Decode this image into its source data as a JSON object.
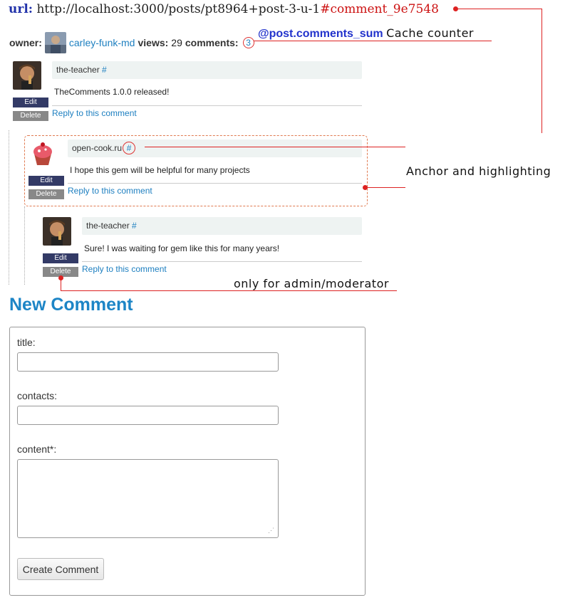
{
  "url_bar": {
    "label": "url:",
    "path": "http://localhost:3000/posts/pt8964+post-3-u-1",
    "anchor": "#comment_9e7548"
  },
  "post_meta": {
    "owner_label": "owner:",
    "owner_name": "carley-funk-md",
    "views_label": "views:",
    "views_value": "29",
    "comments_label": "comments:",
    "comments_value": "3"
  },
  "annotations": {
    "cache_code": "@post.comments_sum",
    "cache_text": "Cache counter",
    "anchor_text": "Anchor and highlighting",
    "admin_text": "only for admin/moderator",
    "color": "#dd2222"
  },
  "comments": [
    {
      "author": "the-teacher",
      "anchor": "#",
      "body": "TheComments 1.0.0 released!",
      "edit_label": "Edit",
      "delete_label": "Delete",
      "reply_label": "Reply to this comment"
    },
    {
      "author": "open-cook.ru",
      "anchor": "#",
      "body": "I hope this gem will be helpful for many projects",
      "edit_label": "Edit",
      "delete_label": "Delete",
      "reply_label": "Reply to this comment"
    },
    {
      "author": "the-teacher",
      "anchor": "#",
      "body": "Sure! I was waiting for gem like this  for many years!",
      "edit_label": "Edit",
      "delete_label": "Delete",
      "reply_label": "Reply to this comment"
    }
  ],
  "new_comment": {
    "heading": "New Comment",
    "title_label": "title:",
    "title_value": "",
    "contacts_label": "contacts:",
    "contacts_value": "",
    "content_label": "content*:",
    "content_value": "",
    "submit_label": "Create Comment"
  },
  "colors": {
    "link": "#1d7fc0",
    "edit_button": "#333a66",
    "delete_button": "#888888",
    "heading": "#1d85c6"
  }
}
